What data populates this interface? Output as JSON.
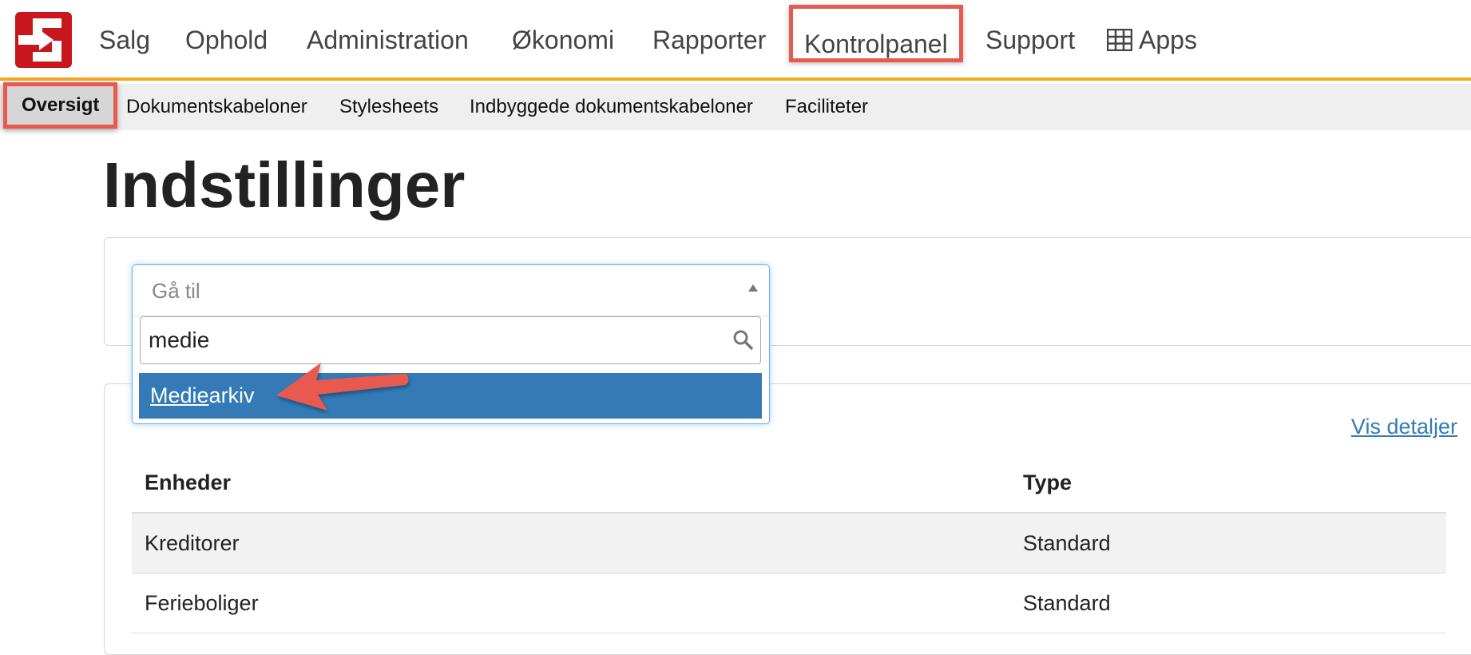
{
  "nav": {
    "items": [
      "Salg",
      "Ophold",
      "Administration",
      "Økonomi",
      "Rapporter",
      "Kontrolpanel",
      "Support"
    ],
    "apps_label": "Apps",
    "highlighted": "Kontrolpanel"
  },
  "subnav": {
    "items": [
      "Oversigt",
      "Dokumentskabeloner",
      "Stylesheets",
      "Indbyggede dokumentskabeloner",
      "Faciliteter"
    ],
    "active": "Oversigt"
  },
  "page": {
    "title": "Indstillinger"
  },
  "dropdown": {
    "placeholder": "Gå til",
    "search_value": "medie",
    "option_match": "Medie",
    "option_rest": "arkiv"
  },
  "panel": {
    "vis_detaljer": "Vis detaljer",
    "table": {
      "headers": [
        "Enheder",
        "Type"
      ],
      "rows": [
        [
          "Kreditorer",
          "Standard"
        ],
        [
          "Ferieboliger",
          "Standard"
        ]
      ]
    }
  },
  "colors": {
    "brand_red": "#c8161d",
    "nav_accent": "#f5a623",
    "annotation": "#e85a4f",
    "selection_blue": "#337ab7"
  }
}
